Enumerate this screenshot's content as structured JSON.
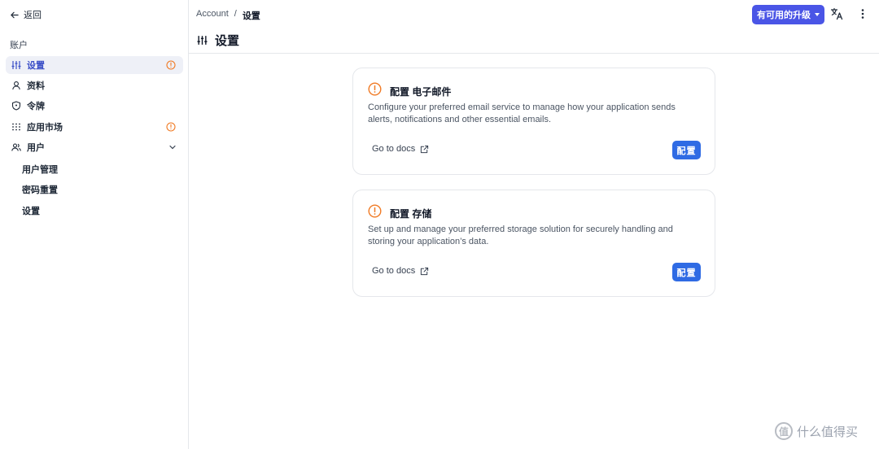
{
  "sidebar": {
    "back_label": "返回",
    "section_label": "账户",
    "items": [
      {
        "label": "设置",
        "icon": "sliders-icon",
        "active": true,
        "warning": true
      },
      {
        "label": "资料",
        "icon": "user-icon"
      },
      {
        "label": "令牌",
        "icon": "shield-icon"
      },
      {
        "label": "应用市场",
        "icon": "grid-icon",
        "warning": true
      },
      {
        "label": "用户",
        "icon": "users-icon",
        "expanded": true
      }
    ],
    "sub_items": [
      "用户管理",
      "密码重置",
      "设置"
    ]
  },
  "header": {
    "breadcrumb": [
      "Account",
      "/",
      "设置"
    ],
    "title": "设置",
    "upgrade_label": "有可用的升级"
  },
  "cards": [
    {
      "title": "配置 电子邮件",
      "description": "Configure your preferred email service to manage how your application sends alerts, notifications and other essential emails.",
      "docs_label": "Go to docs",
      "button_label": "配置"
    },
    {
      "title": "配置 存储",
      "description": "Set up and manage your preferred storage solution for securely handling and storing your application’s data.",
      "docs_label": "Go to docs",
      "button_label": "配置"
    }
  ],
  "watermark": {
    "logo_text": "值",
    "text": "什么值得买"
  },
  "colors": {
    "accent": "#4a55e6",
    "button_blue": "#2f6be4",
    "warning": "#f07a24",
    "active_bg": "#eef0f7",
    "active_text": "#3b4fc7"
  }
}
